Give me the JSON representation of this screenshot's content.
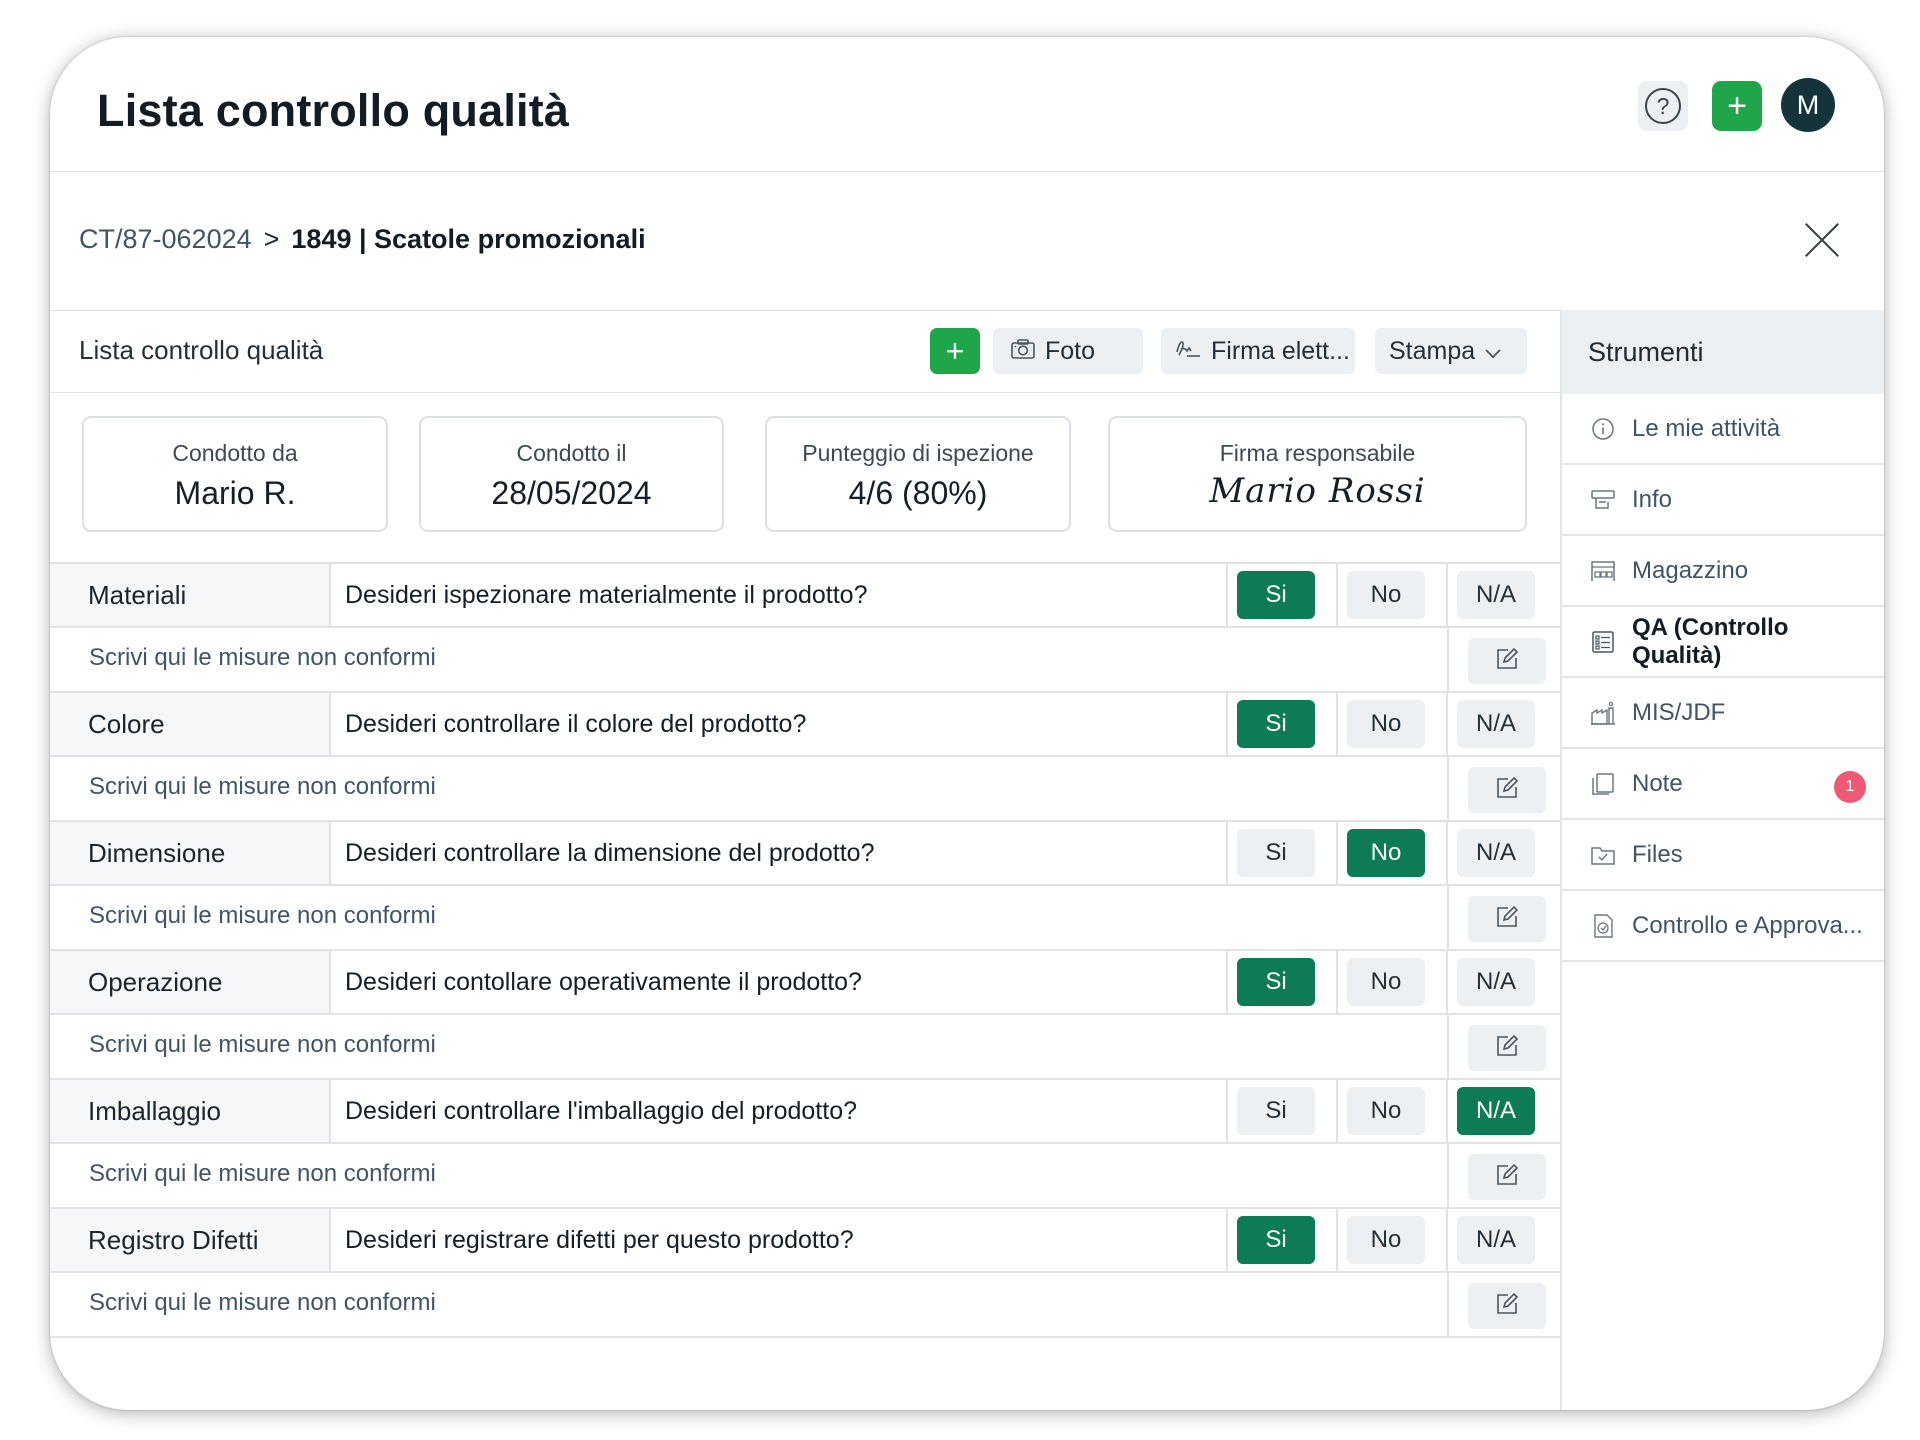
{
  "header": {
    "title": "Lista controllo qualità",
    "help_glyph": "?",
    "add_glyph": "+",
    "avatar_initial": "M"
  },
  "breadcrumb": {
    "code": "CT/87-062024",
    "separator": ">",
    "title": "1849 | Scatole promozionali"
  },
  "toolbar": {
    "label": "Lista controllo qualità",
    "add_glyph": "+",
    "foto_label": "Foto",
    "firma_label": "Firma elett...",
    "stampa_label": "Stampa"
  },
  "stats": {
    "condotto_da": {
      "label": "Condotto da",
      "value": "Mario R."
    },
    "condotto_il": {
      "label": "Condotto il",
      "value": "28/05/2024"
    },
    "punteggio": {
      "label": "Punteggio di ispezione",
      "value": "4/6 (80%)"
    },
    "firma": {
      "label": "Firma responsabile",
      "value": "Mario Rossi"
    }
  },
  "options": {
    "si": "Si",
    "no": "No",
    "na": "N/A"
  },
  "note_placeholder": "Scrivi qui le misure non conformi",
  "checklist": [
    {
      "category": "Materiali",
      "question": "Desideri ispezionare materialmente il prodotto?",
      "selected": "si",
      "note": "Scrivi qui le misure non conformi"
    },
    {
      "category": "Colore",
      "question": "Desideri controllare il colore del prodotto?",
      "selected": "si",
      "note": "Scrivi qui le misure non conformi"
    },
    {
      "category": "Dimensione",
      "question": "Desideri controllare la dimensione del prodotto?",
      "selected": "no",
      "note": "Scrivi qui le misure non conformi"
    },
    {
      "category": "Operazione",
      "question": "Desideri contollare operativamente il prodotto?",
      "selected": "si",
      "note": "Scrivi qui le misure non conformi"
    },
    {
      "category": "Imballaggio",
      "question": "Desideri controllare l'imballaggio del prodotto?",
      "selected": "na",
      "note": "Scrivi qui le misure non conformi"
    },
    {
      "category": "Registro Difetti",
      "question": "Desideri registrare difetti per questo prodotto?",
      "selected": "si",
      "note": "Scrivi qui le misure non conformi"
    }
  ],
  "panel": {
    "title": "Strumenti",
    "items": [
      {
        "label": "Le mie attività",
        "icon": "info-circle-icon",
        "active": false
      },
      {
        "label": "Info",
        "icon": "info-card-icon",
        "active": false
      },
      {
        "label": "Magazzino",
        "icon": "warehouse-icon",
        "active": false
      },
      {
        "label": "QA (Controllo Qualità)",
        "icon": "checklist-icon",
        "active": true
      },
      {
        "label": "MIS/JDF",
        "icon": "factory-icon",
        "active": false
      },
      {
        "label": "Note",
        "icon": "notes-icon",
        "active": false,
        "badge": "1"
      },
      {
        "label": "Files",
        "icon": "folder-icon",
        "active": false
      },
      {
        "label": "Controllo e Approva...",
        "icon": "approval-icon",
        "active": false
      }
    ]
  },
  "colors": {
    "selected_option": "#0d7b53",
    "add_green": "#1fa64a",
    "avatar": "#15343a",
    "badge": "#ee5a73"
  }
}
